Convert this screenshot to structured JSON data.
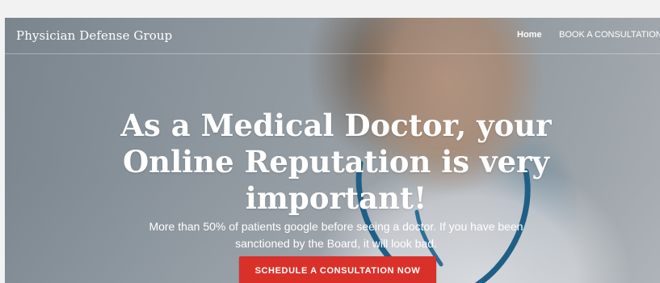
{
  "header": {
    "brand": "Physician Defense Group",
    "nav": [
      {
        "label": "Home",
        "active": true
      },
      {
        "label": "BOOK A CONSULTATION",
        "active": false
      }
    ]
  },
  "hero": {
    "headline": "As a Medical Doctor, your Online Reputation is very important!",
    "subtext": "More than 50% of patients google before seeing a doctor. If you have been sanctioned by the Board, it will look bad.",
    "cta_label": "SCHEDULE A CONSULTATION NOW"
  },
  "colors": {
    "cta_background": "#d9312a",
    "text": "#ffffff"
  }
}
